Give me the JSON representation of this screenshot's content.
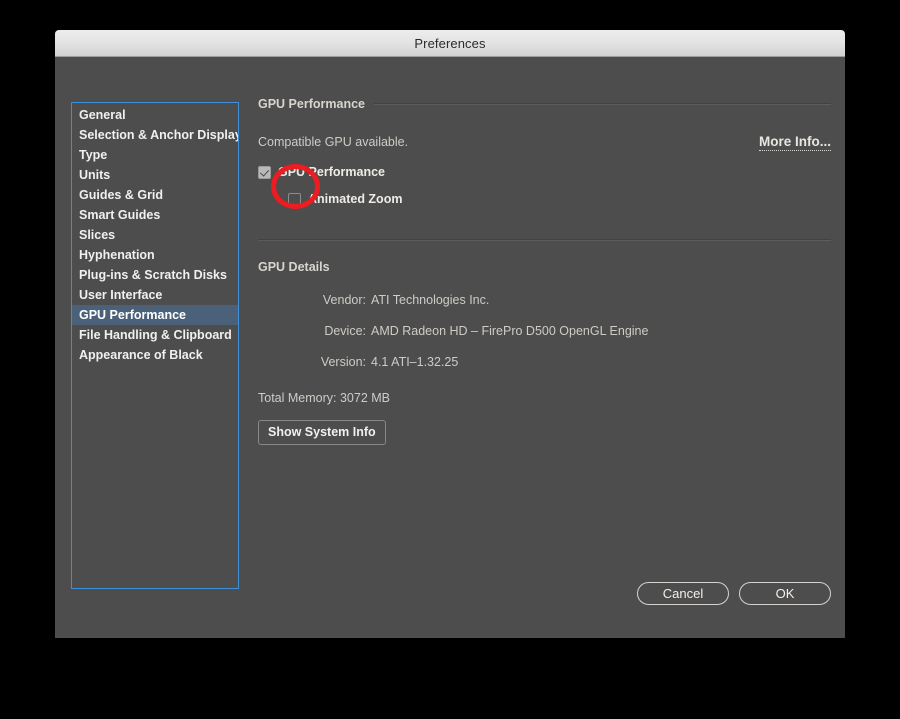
{
  "window": {
    "title": "Preferences"
  },
  "sidebar": {
    "items": [
      {
        "label": "General",
        "selected": false
      },
      {
        "label": "Selection & Anchor Display",
        "selected": false
      },
      {
        "label": "Type",
        "selected": false
      },
      {
        "label": "Units",
        "selected": false
      },
      {
        "label": "Guides & Grid",
        "selected": false
      },
      {
        "label": "Smart Guides",
        "selected": false
      },
      {
        "label": "Slices",
        "selected": false
      },
      {
        "label": "Hyphenation",
        "selected": false
      },
      {
        "label": "Plug-ins & Scratch Disks",
        "selected": false
      },
      {
        "label": "User Interface",
        "selected": false
      },
      {
        "label": "GPU Performance",
        "selected": true
      },
      {
        "label": "File Handling & Clipboard",
        "selected": false
      },
      {
        "label": "Appearance of Black",
        "selected": false
      }
    ]
  },
  "panel": {
    "section_title": "GPU Performance",
    "status_text": "Compatible GPU available.",
    "more_info_label": "More Info...",
    "checkboxes": [
      {
        "label": "GPU Performance",
        "checked": true,
        "disabled": true,
        "indented": false
      },
      {
        "label": "Animated Zoom",
        "checked": false,
        "disabled": false,
        "indented": true
      }
    ],
    "details_title": "GPU Details",
    "details": [
      {
        "label": "Vendor:",
        "value": "ATI Technologies Inc."
      },
      {
        "label": "Device:",
        "value": "AMD Radeon HD – FirePro D500 OpenGL Engine"
      },
      {
        "label": "Version:",
        "value": "4.1 ATI–1.32.25"
      }
    ],
    "total_memory": "Total Memory: 3072 MB",
    "system_info_button": "Show System Info"
  },
  "footer": {
    "cancel_label": "Cancel",
    "ok_label": "OK"
  },
  "annotation": {
    "shape": "ellipse",
    "color": "#ee1b20",
    "target": "Animated Zoom checkbox"
  },
  "colors": {
    "dialog_background": "#4d4d4d",
    "titlebar": "#e3e3e3",
    "selection": "#4a6179",
    "focus_ring": "#3d8fd8",
    "annotation_red": "#ee1b20",
    "page_background": "#000000"
  }
}
